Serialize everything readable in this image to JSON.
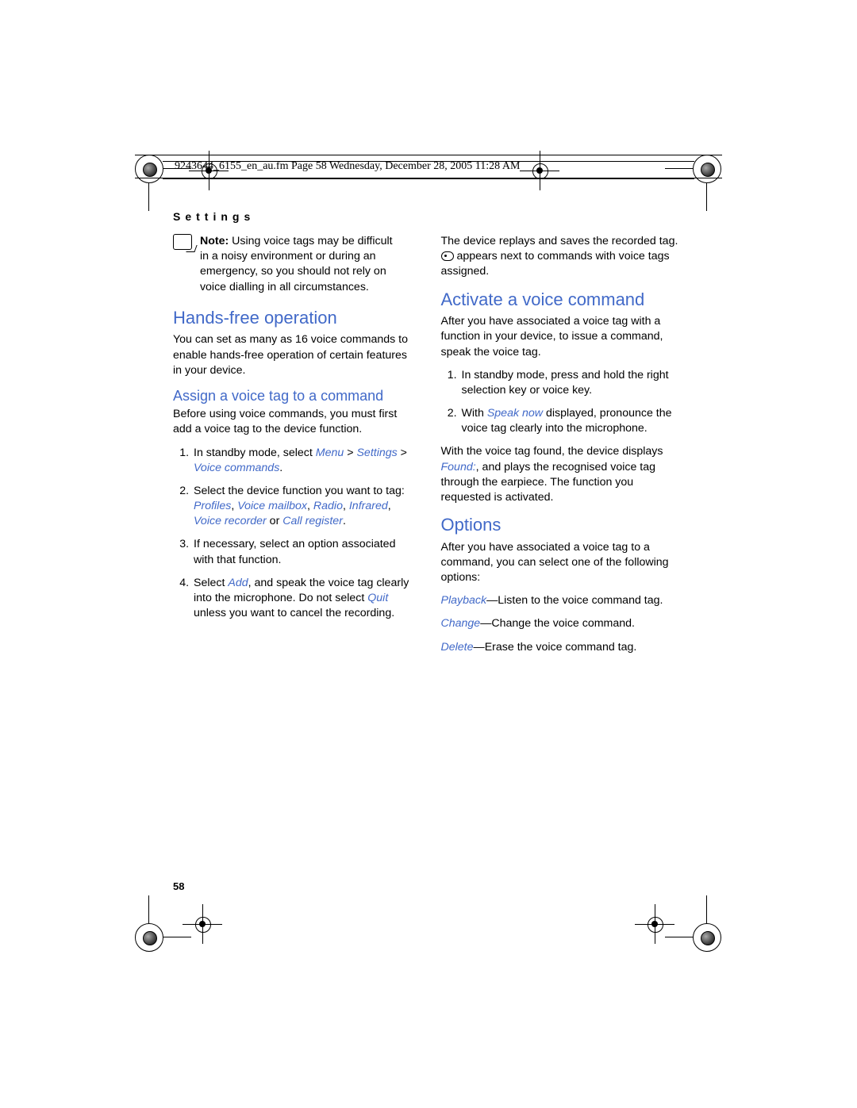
{
  "crop_header": "9243644_6155_en_au.fm  Page 58  Wednesday, December 28, 2005  11:28 AM",
  "section_label": "Settings",
  "page_number": "58",
  "note": {
    "label": "Note:",
    "text": " Using voice tags may be difficult in a noisy environment or during an emergency, so you should not rely on voice dialling in all circumstances."
  },
  "h_hands_free": "Hands-free operation",
  "p_hands_free": "You can set as many as 16 voice commands to enable hands-free operation of certain features in your device.",
  "h_assign": "Assign a voice tag to a command",
  "p_assign_intro": "Before using voice commands, you must first add a voice tag to the device function.",
  "assign_list": {
    "i1_a": "In standby mode, select ",
    "i1_menu": "Menu",
    "i1_gt": " > ",
    "i1_settings": "Settings",
    "i1_gt2": " > ",
    "i1_vc": "Voice commands",
    "i1_dot": ".",
    "i2_a": "Select the device function you want to tag: ",
    "i2_profiles": "Profiles",
    "c1": ", ",
    "i2_vm": "Voice mailbox",
    "c2": ", ",
    "i2_radio": "Radio",
    "c3": ", ",
    "i2_ir": "Infrared",
    "c4": ", ",
    "i2_vr": "Voice recorder",
    "i2_or": " or ",
    "i2_cr": "Call register",
    "i2_dot": ".",
    "i3": "If necessary, select an option associated with that function.",
    "i4_a": "Select ",
    "i4_add": "Add",
    "i4_b": ", and speak the voice tag clearly into the microphone. Do not select ",
    "i4_quit": "Quit",
    "i4_c": " unless you want to cancel the recording."
  },
  "p_replay_a": "The device replays and saves the recorded tag. ",
  "p_replay_b": " appears next to commands with voice tags assigned.",
  "h_activate": "Activate a voice command",
  "p_activate_intro": "After you have associated a voice tag with a function in your device, to issue a command, speak the voice tag.",
  "activate_list": {
    "i1": "In standby mode, press and hold the right selection key or voice key.",
    "i2_a": "With ",
    "i2_speak": "Speak now",
    "i2_b": " displayed, pronounce the voice tag clearly into the microphone."
  },
  "p_found_a": "With the voice tag found, the device displays ",
  "p_found_found": "Found:",
  "p_found_b": ", and plays the recognised voice tag through the earpiece. The function you requested is activated.",
  "h_options": "Options",
  "p_options_intro": "After you have associated a voice tag to a command, you can select one of the following options:",
  "opt_playback": "Playback",
  "opt_playback_t": "—Listen to the voice command tag.",
  "opt_change": "Change",
  "opt_change_t": "—Change the voice command.",
  "opt_delete": "Delete",
  "opt_delete_t": "—Erase the voice command tag."
}
